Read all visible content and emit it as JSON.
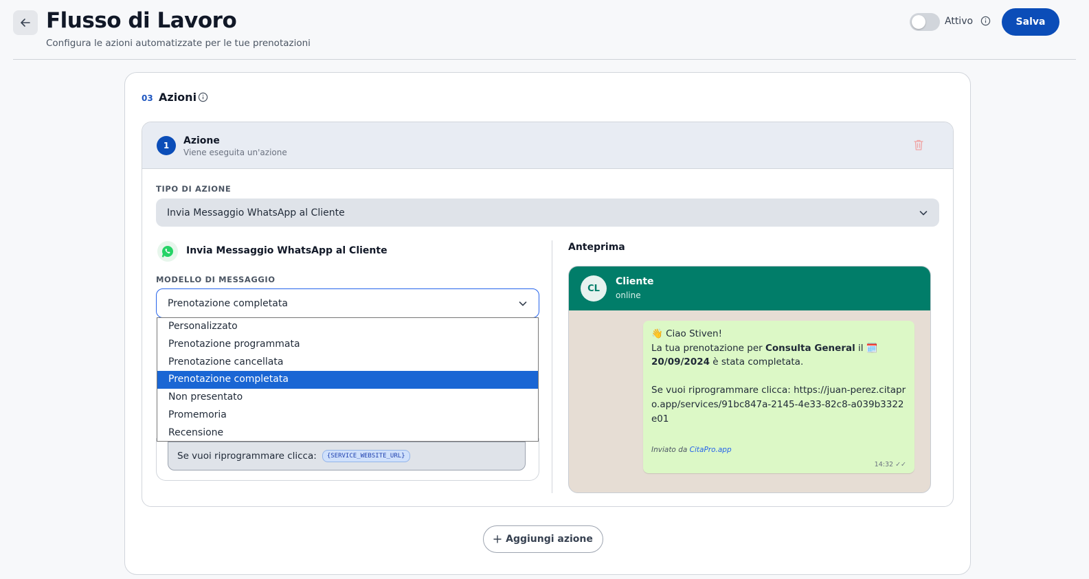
{
  "header": {
    "title": "Flusso di Lavoro",
    "subtitle": "Configura le azioni automatizzate per le tue prenotazioni",
    "toggle_label": "Attivo",
    "toggle_on": false,
    "save_label": "Salva"
  },
  "section": {
    "number": "03",
    "title": "Azioni"
  },
  "action": {
    "step": "1",
    "title": "Azione",
    "subtitle": "Viene eseguita un'azione",
    "type_label": "TIPO DI AZIONE",
    "type_value": "Invia Messaggio WhatsApp al Cliente",
    "channel_title": "Invia Messaggio WhatsApp al Cliente",
    "model_label": "MODELLO DI MESSAGGIO",
    "model_value": "Prenotazione completata",
    "model_options": [
      "Personalizzato",
      "Prenotazione programmata",
      "Prenotazione cancellata",
      "Prenotazione completata",
      "Non presentato",
      "Promemoria",
      "Recensione"
    ],
    "message_line": "Se vuoi riprogrammare clicca:",
    "message_token": "{SERVICE_WEBSITE_URL}"
  },
  "preview": {
    "label": "Anteprima",
    "avatar": "CL",
    "contact_name": "Cliente",
    "contact_status": "online",
    "greeting": "👋 Ciao Stiven!",
    "line1_pre": "La tua prenotazione per ",
    "service": "Consulta General",
    "line1_mid": " il 🗓️ ",
    "date": "20/09/2024",
    "line1_post": " è stata completata.",
    "reschedule": "Se vuoi riprogrammare clicca: https://juan-perez.citapro.app/services/91bc847a-2145-4e33-82c8-a039b3322e01",
    "sent_by_prefix": "Inviato da ",
    "sent_by_link": "CitaPro.app",
    "time": "14:32 ✓✓"
  },
  "add_action_label": "Aggiungi azione",
  "colors": {
    "primary": "#0b4db8",
    "whatsapp_header": "#017d69",
    "bubble": "#dcf8c6",
    "selected_option": "#1a66d4"
  }
}
